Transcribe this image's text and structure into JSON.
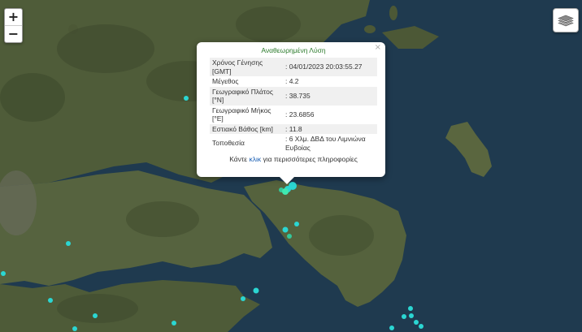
{
  "map_controls": {
    "zoom_in": "+",
    "zoom_out": "−",
    "layers_icon": "layers-icon"
  },
  "popup": {
    "title": "Αναθεωρημένη Λύση",
    "close": "×",
    "rows": [
      {
        "label": "Χρόνος Γένησης [GMT]",
        "value": ": 04/01/2023 20:03:55.27"
      },
      {
        "label": "Μέγεθος",
        "value": ": 4.2"
      },
      {
        "label": "Γεωγραφικό Πλάτος [°N]",
        "value": ": 38.735"
      },
      {
        "label": "Γεωγραφικό Μήκος [°E]",
        "value": ": 23.6856"
      },
      {
        "label": "Εστιακό Βάθος [km]",
        "value": ": 11.8"
      },
      {
        "label": "Τοποθεσία",
        "value": ": 6 Χλμ. ΔΒΔ του Λιμνιώνα Ευβοίας"
      }
    ],
    "more_prefix": "Κάντε ",
    "more_link": "κλικ",
    "more_suffix": " για περισσότερες πληροφορίες"
  },
  "colors": {
    "sea": "#1f3a4f",
    "land": "#4d5a38",
    "marker": "#2bd6d2",
    "marker_highlight": "#3fe8b0"
  }
}
